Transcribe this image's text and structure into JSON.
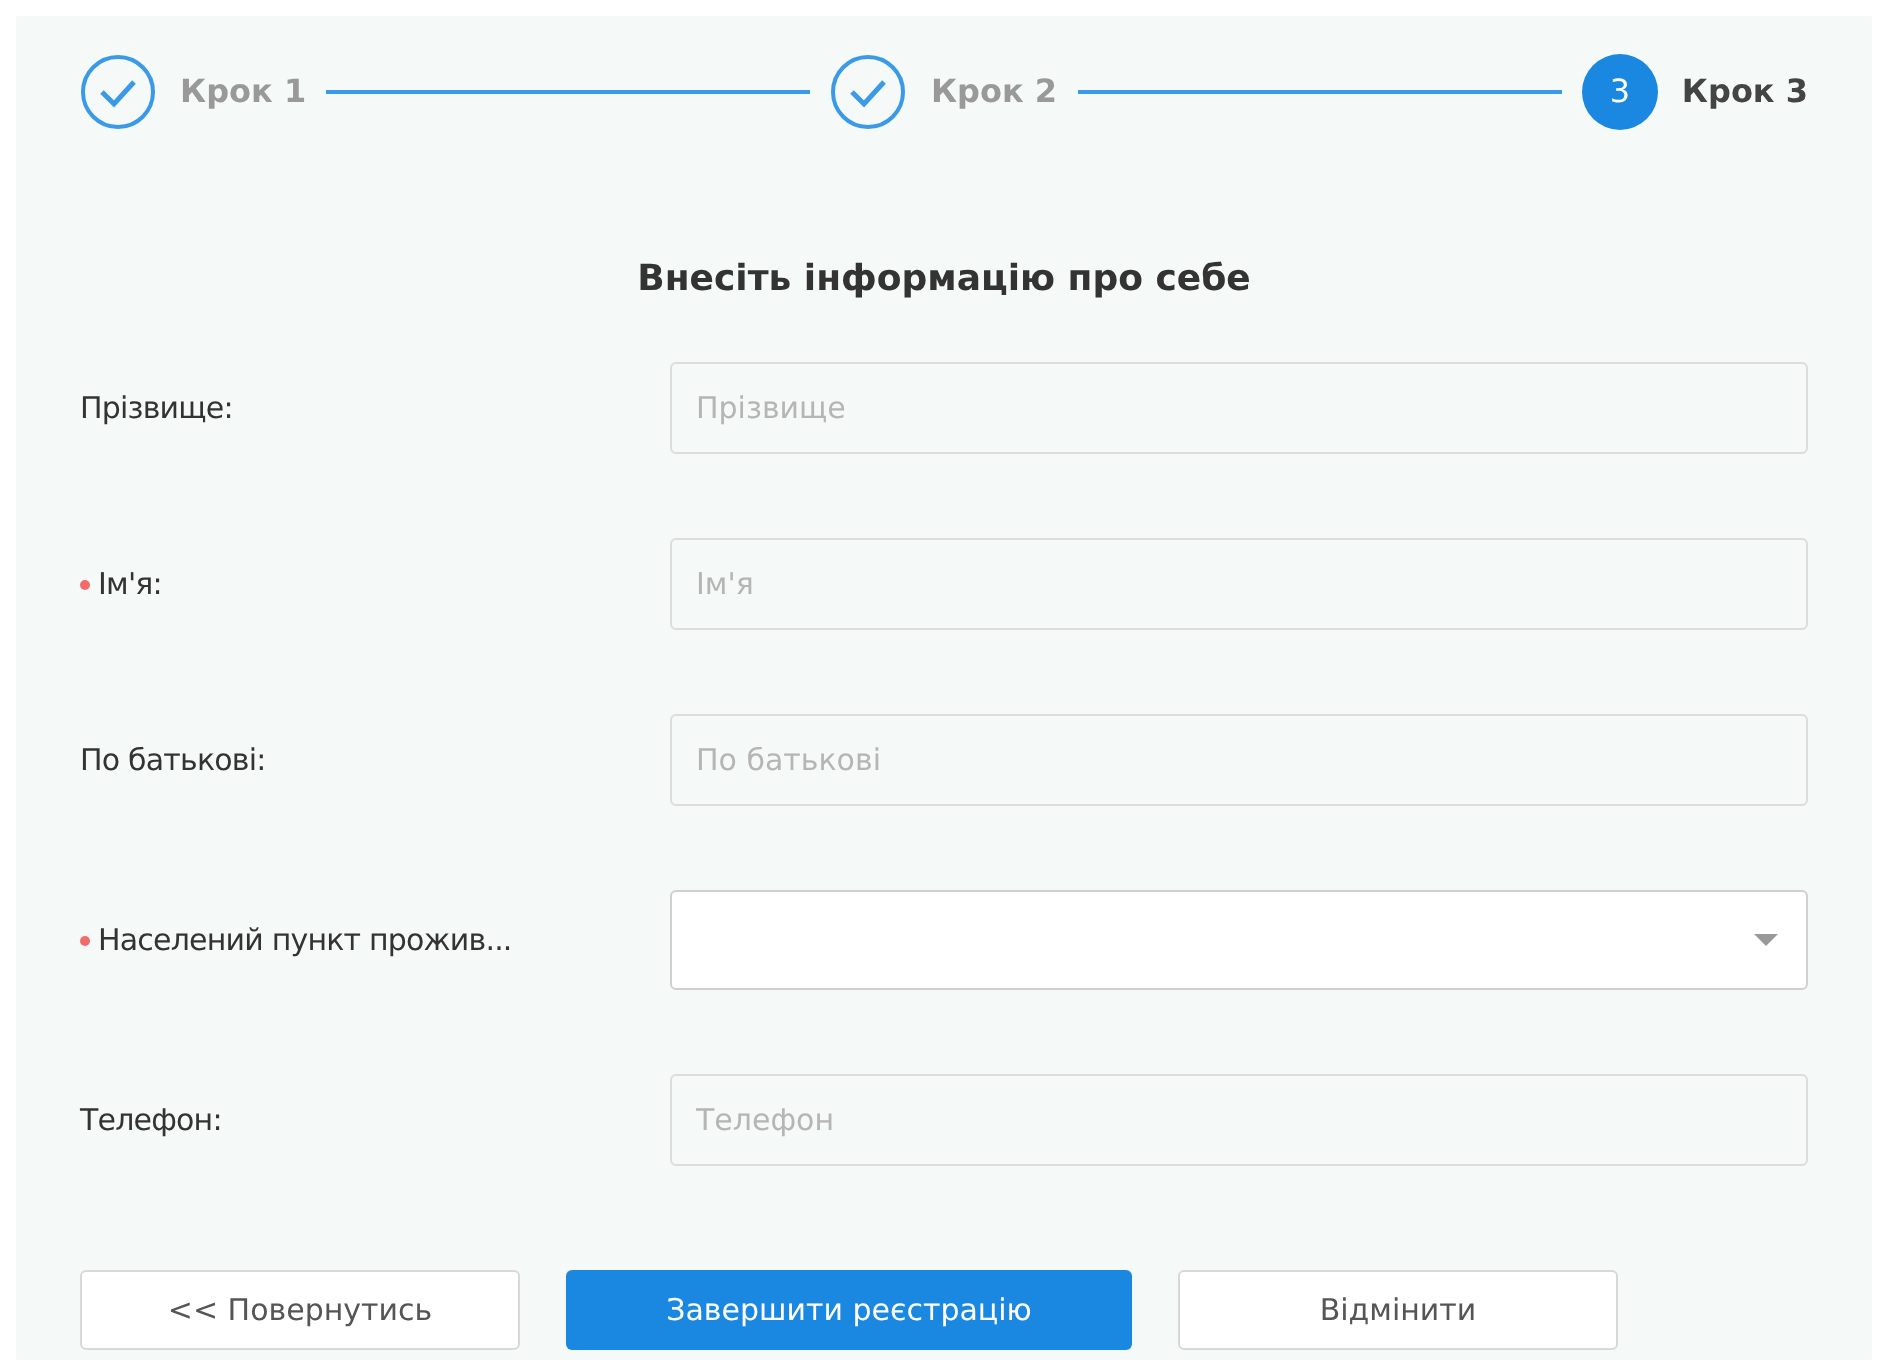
{
  "steps": [
    {
      "label": "Крок 1",
      "completed": true,
      "selected": false
    },
    {
      "label": "Крок 2",
      "completed": true,
      "selected": false
    },
    {
      "label": "Крок 3",
      "completed": false,
      "selected": true,
      "number": "3"
    }
  ],
  "title": "Внесіть інформацію про себе",
  "fields": [
    {
      "kind": "input",
      "label": "Прізвище:",
      "required": false,
      "placeholder": "Прізвище"
    },
    {
      "kind": "input",
      "label": "Ім'я:",
      "required": true,
      "placeholder": "Ім'я"
    },
    {
      "kind": "input",
      "label": "По батькові:",
      "required": false,
      "placeholder": "По батькові"
    },
    {
      "kind": "select",
      "label": "Населений пункт прожив...",
      "required": true
    },
    {
      "kind": "input",
      "label": "Телефон:",
      "required": false,
      "placeholder": "Телефон"
    }
  ],
  "buttons": [
    {
      "label": "<< Повернутись",
      "kind": "default"
    },
    {
      "label": "Завершити реєстрацію",
      "kind": "primary"
    },
    {
      "label": "Відмінити",
      "kind": "default"
    }
  ]
}
